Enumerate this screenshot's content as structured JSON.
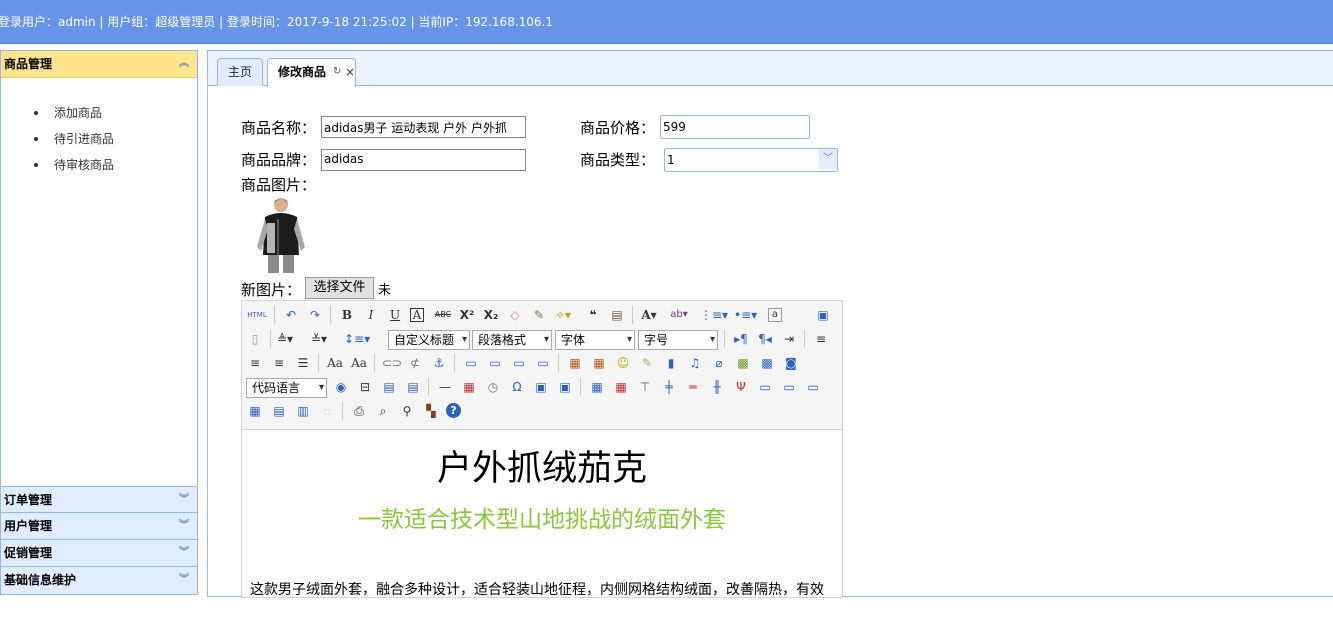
{
  "header": {
    "info": "登录用户：admin | 用户组：超级管理员 | 登录时间：2017-9-18 21:25:02  |  当前IP：192.168.106.1"
  },
  "sidebar": {
    "sections": [
      {
        "title": "商品管理",
        "expanded": true,
        "items": [
          "添加商品",
          "待引进商品",
          "待审核商品"
        ]
      },
      {
        "title": "订单管理",
        "expanded": false
      },
      {
        "title": "用户管理",
        "expanded": false
      },
      {
        "title": "促销管理",
        "expanded": false
      },
      {
        "title": "基础信息维护",
        "expanded": false
      }
    ]
  },
  "tabs": [
    {
      "label": "主页",
      "active": false
    },
    {
      "label": "修改商品",
      "active": true
    }
  ],
  "form": {
    "name_label": "商品名称：",
    "name_value": "adidas男子  运动表现  户外 户外抓",
    "price_label": "商品价格：",
    "price_value": "599",
    "brand_label": "商品品牌：",
    "brand_value": "adidas",
    "type_label": "商品类型：",
    "type_value": "1",
    "image_label": "商品图片：",
    "new_image_label": "新图片：",
    "file_button": "选择文件",
    "file_status": "未选择任何文件"
  },
  "editor": {
    "toolbar": {
      "custom_heading": "自定义标题",
      "paragraph_format": "段落格式",
      "font_family": "字体",
      "font_size": "字号",
      "code_language": "代码语言"
    },
    "content": {
      "title": "户外抓绒茄克",
      "subtitle": "一款适合技术型山地挑战的绒面外套",
      "paragraph": "这款男子绒面外套，融合多种设计，适合轻装山地征程，内侧网格结构绒面，改善隔热，有效"
    }
  },
  "colors": {
    "header_bg": "#6694e8",
    "active_section_bg": "#ffe48d",
    "subtitle_green": "#8dc63f",
    "panel_border": "#95b8e7"
  }
}
